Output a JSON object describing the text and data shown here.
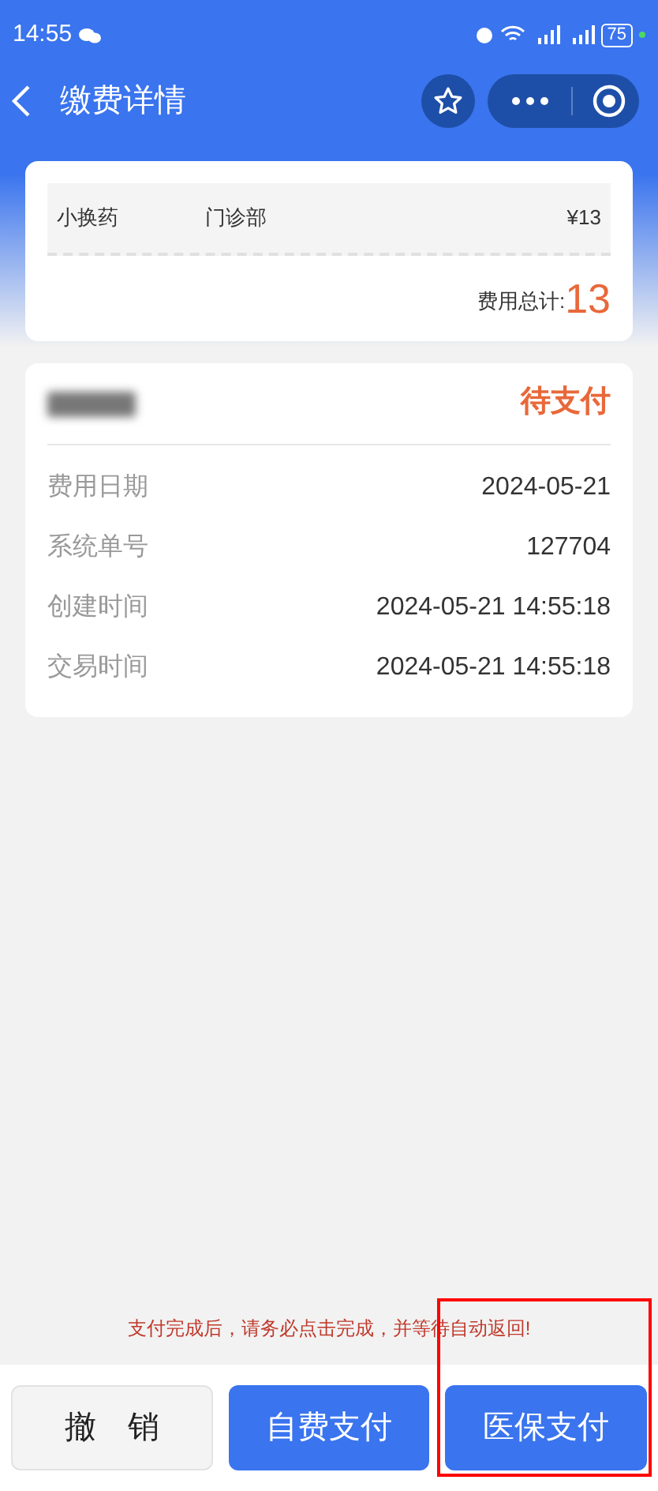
{
  "status_bar": {
    "time": "14:55",
    "battery": "75"
  },
  "header": {
    "title": "缴费详情"
  },
  "fee_card": {
    "items": [
      {
        "name": "小换药",
        "department": "门诊部",
        "price": "¥13"
      }
    ],
    "total_label": "费用总计:",
    "total": "13"
  },
  "order_card": {
    "status": "待支付",
    "fields": [
      {
        "label": "费用日期",
        "value": "2024-05-21"
      },
      {
        "label": "系统单号",
        "value": "127704"
      },
      {
        "label": "创建时间",
        "value": "2024-05-21 14:55:18"
      },
      {
        "label": "交易时间",
        "value": "2024-05-21 14:55:18"
      }
    ]
  },
  "notice": "支付完成后，请务必点击完成，并等待自动返回!",
  "buttons": [
    {
      "label": "撤　销",
      "kind": "secondary",
      "highlighted": false
    },
    {
      "label": "自费支付",
      "kind": "primary",
      "highlighted": false
    },
    {
      "label": "医保支付",
      "kind": "primary",
      "highlighted": true
    }
  ]
}
